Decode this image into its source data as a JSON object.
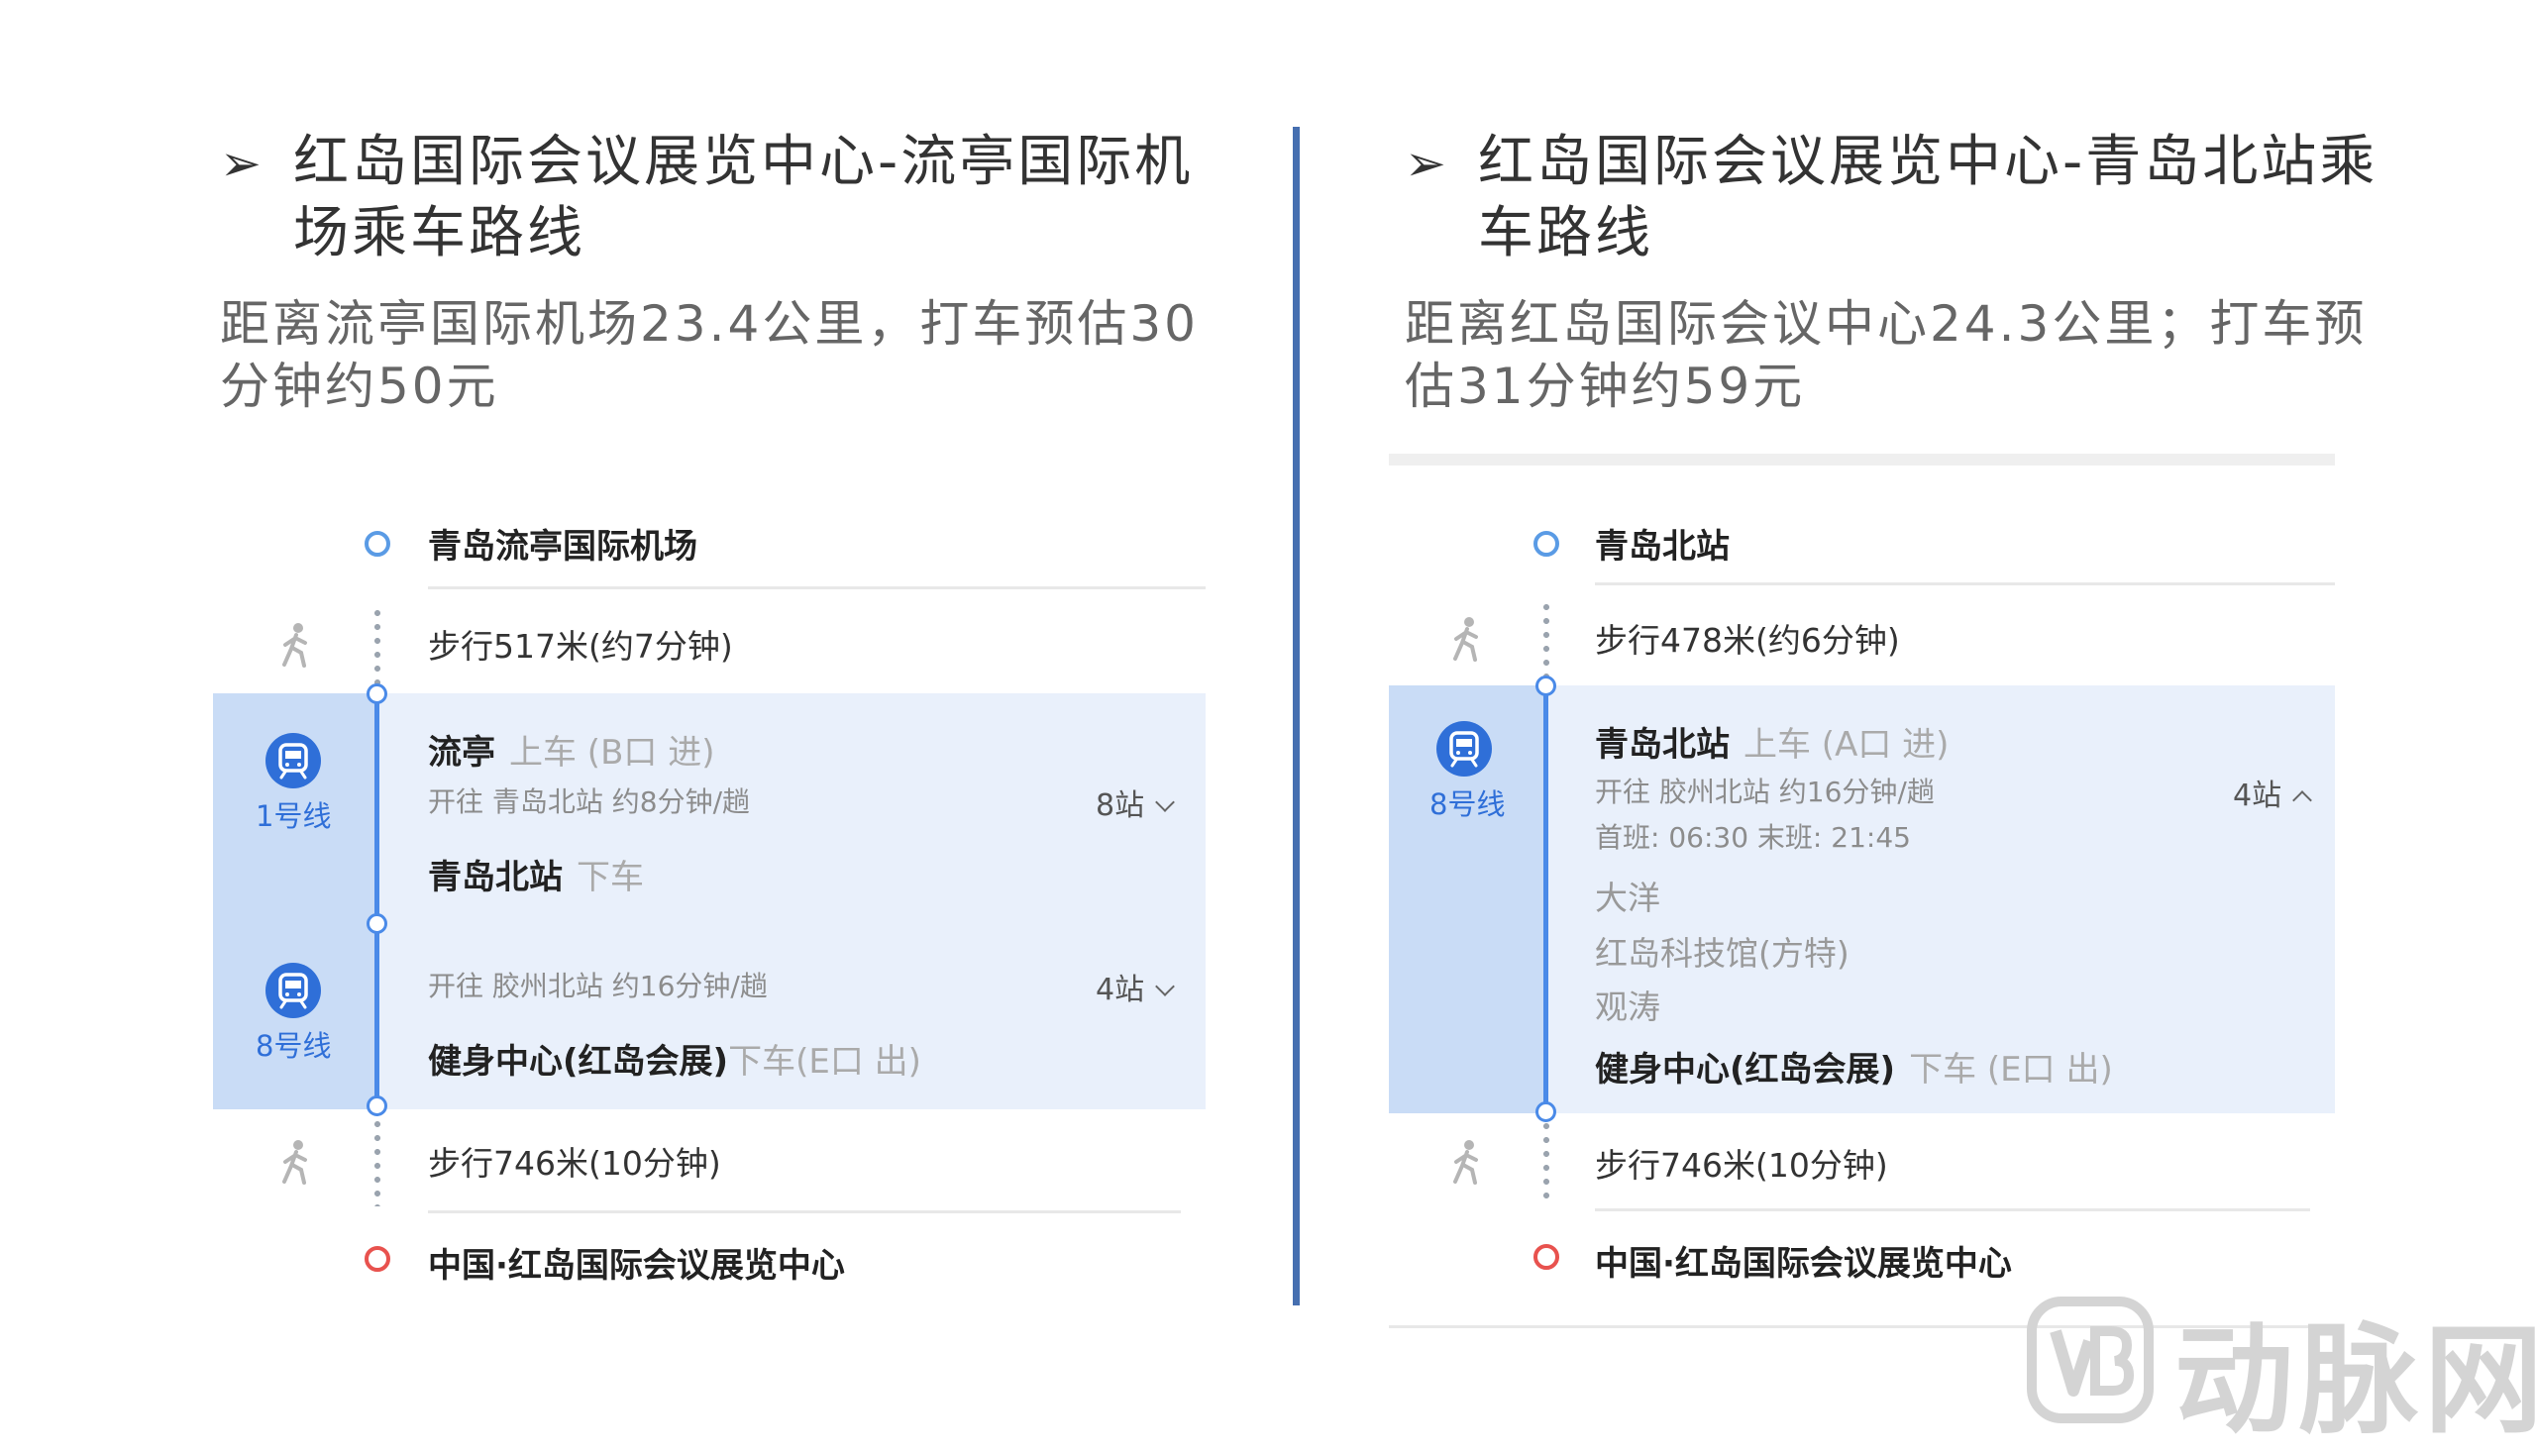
{
  "left": {
    "title_line1": "红岛国际会议展览中心-流亭国际机",
    "title_line2": "场乘车路线",
    "desc_line1": "距离流亭国际机场23.4公里，打车预估30",
    "desc_line2": "分钟约50元",
    "origin": "青岛流亭国际机场",
    "walk1": "步行517米(约7分钟)",
    "board_station": "流亭",
    "board_note": "上车 (B口 进)",
    "line1_label": "1号线",
    "line1_dir": "开往 青岛北站 约8分钟/趟",
    "line1_count": "8站",
    "transfer_station": "青岛北站",
    "transfer_note": "下车",
    "line2_label": "8号线",
    "line2_dir": "开往 胶州北站 约16分钟/趟",
    "line2_count": "4站",
    "alight_station": "健身中心(红岛会展)",
    "alight_note": "下车(E口 出)",
    "walk2": "步行746米(10分钟)",
    "destination": "中国·红岛国际会议展览中心"
  },
  "right": {
    "title_line1": "红岛国际会议展览中心-青岛北站乘",
    "title_line2": "车路线",
    "desc_line1": "距离红岛国际会议中心24.3公里；打车预",
    "desc_line2": "估31分钟约59元",
    "origin": "青岛北站",
    "walk1": "步行478米(约6分钟)",
    "board_station": "青岛北站",
    "board_note": "上车 (A口 进)",
    "line_label": "8号线",
    "line_dir": "开往 胶州北站 约16分钟/趟",
    "line_count": "4站",
    "schedule": "首班: 06:30 末班: 21:45",
    "stops": [
      "大洋",
      "红岛科技馆(方特)",
      "观涛"
    ],
    "alight_station": "健身中心(红岛会展)",
    "alight_note": "下车 (E口 出)",
    "walk2": "步行746米(10分钟)",
    "destination": "中国·红岛国际会议展览中心"
  },
  "watermark": {
    "text": "动脉网"
  },
  "colors": {
    "divider": "#466fb0",
    "route_line": "#4a8ae8",
    "highlight_bg": "#e9f0fb",
    "lane_bg": "#c9dcf6",
    "badge": "#2f6fd8",
    "origin_ring": "#5a9be5",
    "destination_ring": "#e8524e"
  }
}
